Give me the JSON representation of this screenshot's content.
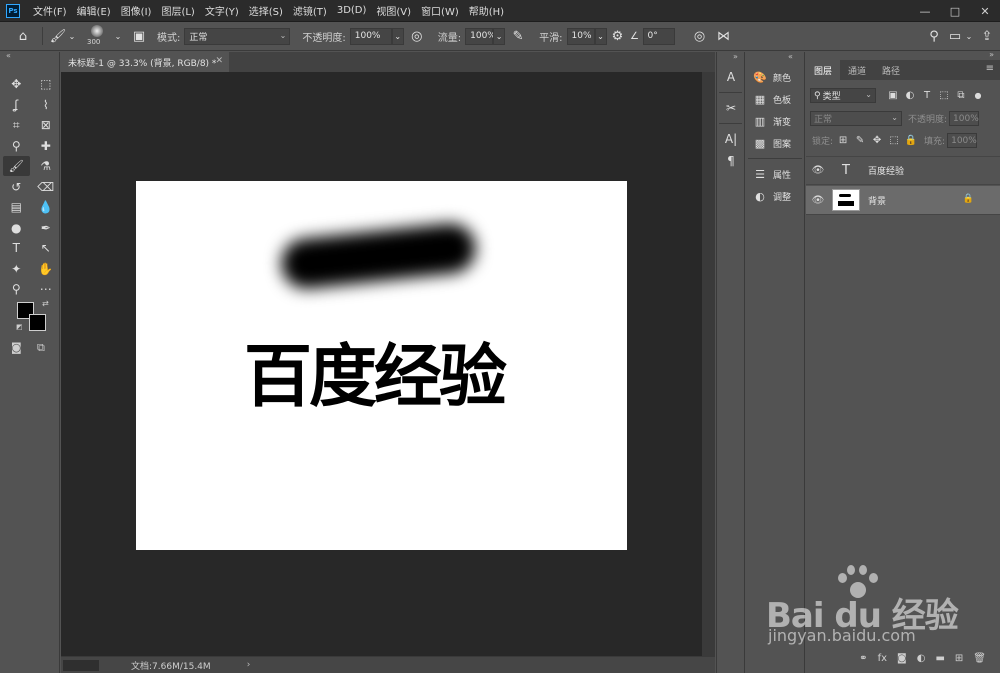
{
  "app": {
    "logo": "Ps"
  },
  "menu": [
    "文件(F)",
    "编辑(E)",
    "图像(I)",
    "图层(L)",
    "文字(Y)",
    "选择(S)",
    "滤镜(T)",
    "3D(D)",
    "视图(V)",
    "窗口(W)",
    "帮助(H)"
  ],
  "window_controls": {
    "minimize": "—",
    "maximize": "□",
    "close": "✕"
  },
  "options_bar": {
    "brush_size": "300",
    "mode_label": "模式:",
    "mode_value": "正常",
    "opacity_label": "不透明度:",
    "opacity_value": "100%",
    "flow_label": "流量:",
    "flow_value": "100%",
    "smoothing_label": "平滑:",
    "smoothing_value": "10%",
    "angle_value": "0°"
  },
  "document": {
    "tab_title": "未标题-1 @ 33.3% (背景, RGB/8) *",
    "canvas_text": "百度经验",
    "status_info": "文档:7.66M/15.4M",
    "status_arrow": "›"
  },
  "dock": {
    "items": [
      {
        "label": "颜色",
        "icon": "palette-icon"
      },
      {
        "label": "色板",
        "icon": "swatches-icon"
      },
      {
        "label": "渐变",
        "icon": "gradient-icon"
      },
      {
        "label": "图案",
        "icon": "patterns-icon"
      },
      {
        "label": "属性",
        "icon": "properties-icon"
      },
      {
        "label": "调整",
        "icon": "adjustments-icon"
      }
    ]
  },
  "layers_panel": {
    "tabs": [
      "图层",
      "通道",
      "路径"
    ],
    "filter_kind": "类型",
    "blend_mode": "正常",
    "opacity_label": "不透明度:",
    "opacity_value": "100%",
    "lock_label": "锁定:",
    "fill_label": "填充:",
    "fill_value": "100%",
    "layers": [
      {
        "name": "百度经验",
        "type": "text"
      },
      {
        "name": "背景",
        "type": "image",
        "locked": true
      }
    ]
  },
  "watermark": {
    "brand": "Bai du 经验",
    "url": "jingyan.baidu.com"
  }
}
